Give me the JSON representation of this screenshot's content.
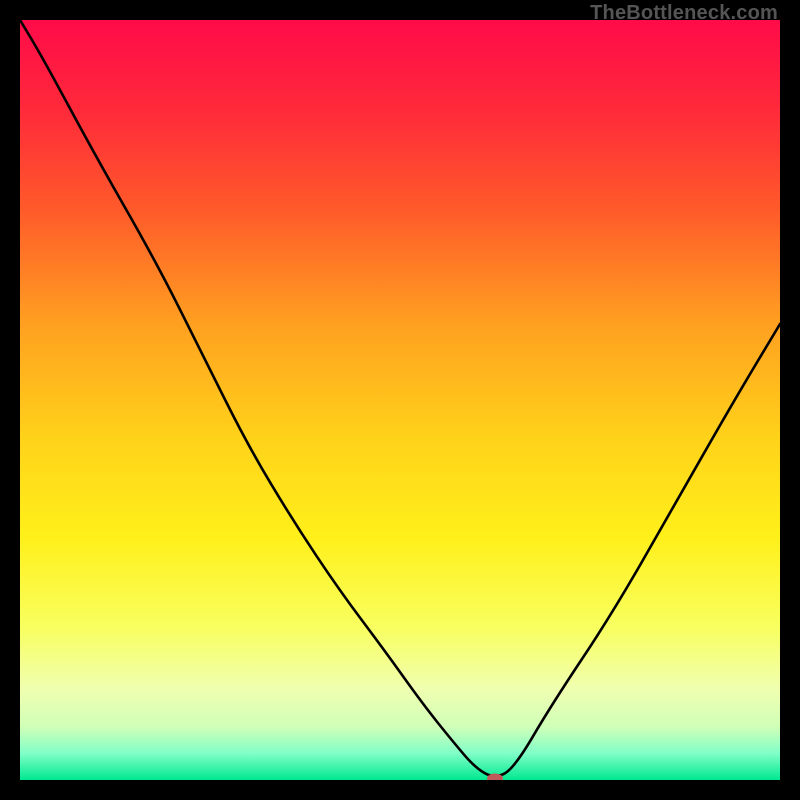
{
  "watermark": "TheBottleneck.com",
  "chart_data": {
    "type": "line",
    "title": "",
    "xlabel": "",
    "ylabel": "",
    "xlim": [
      0,
      100
    ],
    "ylim": [
      0,
      100
    ],
    "background": {
      "type": "vertical-gradient",
      "stops": [
        {
          "offset": 0.0,
          "color": "#ff0b49"
        },
        {
          "offset": 0.12,
          "color": "#ff2a3a"
        },
        {
          "offset": 0.25,
          "color": "#ff5a2a"
        },
        {
          "offset": 0.4,
          "color": "#ffa020"
        },
        {
          "offset": 0.55,
          "color": "#ffd21a"
        },
        {
          "offset": 0.68,
          "color": "#fff01a"
        },
        {
          "offset": 0.8,
          "color": "#f8ff60"
        },
        {
          "offset": 0.88,
          "color": "#f0ffb0"
        },
        {
          "offset": 0.93,
          "color": "#d0ffb8"
        },
        {
          "offset": 0.965,
          "color": "#80ffc8"
        },
        {
          "offset": 1.0,
          "color": "#00e890"
        }
      ]
    },
    "series": [
      {
        "name": "bottleneck-curve",
        "x": [
          0,
          3,
          10,
          18,
          24,
          30,
          36,
          42,
          48,
          53,
          57,
          60,
          62.5,
          65,
          70,
          78,
          86,
          94,
          100
        ],
        "values": [
          100,
          95,
          82,
          68,
          56,
          44,
          34,
          25,
          17,
          10,
          5,
          1.5,
          0.2,
          1.5,
          10,
          22,
          36,
          50,
          60
        ]
      }
    ],
    "marker": {
      "x": 62.5,
      "y": 0.2,
      "color": "#c05a5a",
      "rx": 8,
      "ry": 5
    }
  }
}
